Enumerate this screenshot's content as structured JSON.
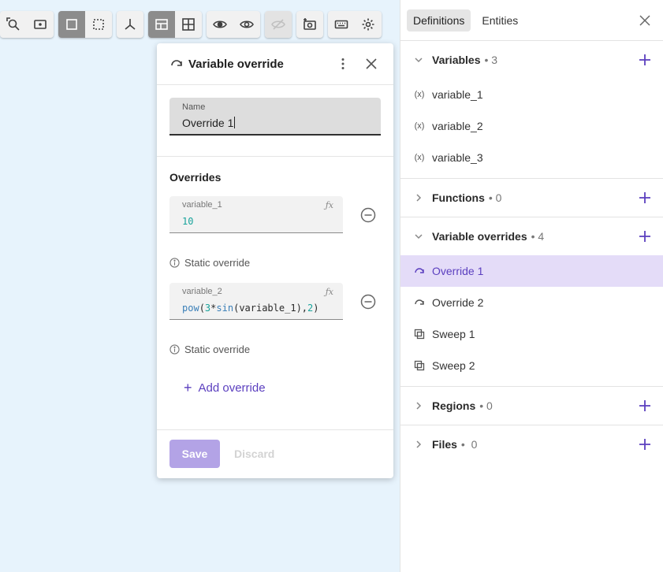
{
  "toolbar": {
    "groups": [
      [
        "zoom-fit-icon",
        "zoom-box-icon"
      ],
      [
        "select-icon",
        "box-select-icon"
      ],
      [
        "axes-icon"
      ],
      [
        "layout-icon",
        "grid-icon"
      ],
      [
        "eye-hide-icon",
        "eye-show-icon"
      ],
      [
        "eye-disabled-icon"
      ],
      [
        "add-camera-icon"
      ],
      [
        "keyboard-icon",
        "gear-icon"
      ]
    ]
  },
  "panel": {
    "title": "Variable override",
    "name_label": "Name",
    "name_value": "Override 1",
    "overrides_heading": "Overrides",
    "overrides": [
      {
        "label": "variable_1",
        "value": "10",
        "note": "Static override"
      },
      {
        "label": "variable_2",
        "value": "pow(3*sin(variable_1),2)",
        "note": "Static override"
      }
    ],
    "add_override": "Add override",
    "save": "Save",
    "discard": "Discard"
  },
  "sidebar": {
    "tabs": [
      "Definitions",
      "Entities"
    ],
    "sections": {
      "variables": {
        "title": "Variables",
        "count": "• 3",
        "items": [
          "variable_1",
          "variable_2",
          "variable_3"
        ]
      },
      "functions": {
        "title": "Functions",
        "count": "• 0"
      },
      "overrides": {
        "title": "Variable overrides",
        "count": "• 4",
        "items": [
          "Override 1",
          "Override 2",
          "Sweep 1",
          "Sweep 2"
        ]
      },
      "regions": {
        "title": "Regions",
        "count": "• 0"
      },
      "files": {
        "title": "Files",
        "count": "•  0"
      }
    }
  },
  "colors": {
    "accent": "#5b3fbf",
    "selected_bg": "#e4dcf8",
    "viewport": "#e7f3fc"
  }
}
